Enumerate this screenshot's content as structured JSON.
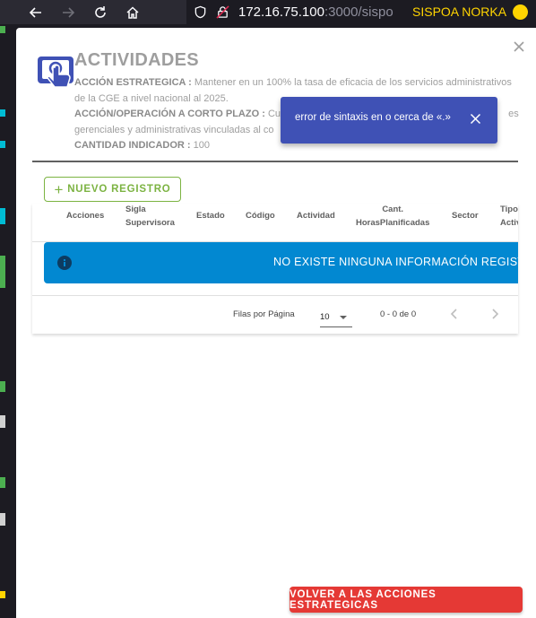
{
  "browser": {
    "url_host": "172.16.75.100",
    "url_rest": ":3000/sispo",
    "extension_label": "SISPOA NORKA",
    "colors": {
      "chrome": "#2b2a33",
      "ext_accent": "#ffd400"
    }
  },
  "dialog": {
    "title": "ACTIVIDADES",
    "accion_estrategica_label": "ACCIÓN ESTRATEGICA :",
    "accion_estrategica_text": "Mantener en un 100% la tasa de eficacia de los servicios administrativos de la CGE a nivel nacional al 2025.",
    "accion_corto_plazo_label": "ACCIÓN/OPERACIÓN A CORTO PLAZO :",
    "accion_corto_plazo_text_start": "Cum",
    "accion_corto_plazo_text_end": "es",
    "accion_corto_plazo_line2": "gerenciales y administrativas vinculadas al co",
    "cantidad_label": "CANTIDAD INDICADOR :",
    "cantidad_value": "100",
    "new_button": "NUEVO REGISTRO",
    "back_button": "VOLVER A LAS ACCIONES ESTRATEGICAS",
    "colors": {
      "new_button": "#7cb342",
      "back_button": "#e53935",
      "alert": "#0288d1",
      "header_icon": "#3f51b5"
    }
  },
  "table": {
    "headers": {
      "acciones": "Acciones",
      "sigla_1": "Sigla",
      "sigla_2": "Supervisora",
      "estado": "Estado",
      "codigo": "Código",
      "actividad": "Actividad",
      "cant_1": "Cant.",
      "cant_2": "HorasPlanificadas",
      "sector": "Sector",
      "tipo_1": "Tipo",
      "tipo_2": "Activ"
    },
    "empty_message": "NO EXISTE NINGUNA INFORMACIÓN REGISTRA",
    "rows_per_page_label": "Filas por Página",
    "rows_per_page_value": "10",
    "range_text": "0 - 0 de 0"
  },
  "snackbar": {
    "message": "error de sintaxis en o cerca de «.»",
    "color": "#3f51b5"
  },
  "icons": [
    "back-arrow-icon",
    "forward-arrow-icon",
    "reload-icon",
    "home-icon",
    "shield-icon",
    "insecure-lock-icon",
    "close-icon",
    "touch-screen-icon",
    "plus-icon",
    "info-icon",
    "chevron-left-icon",
    "chevron-right-icon"
  ]
}
